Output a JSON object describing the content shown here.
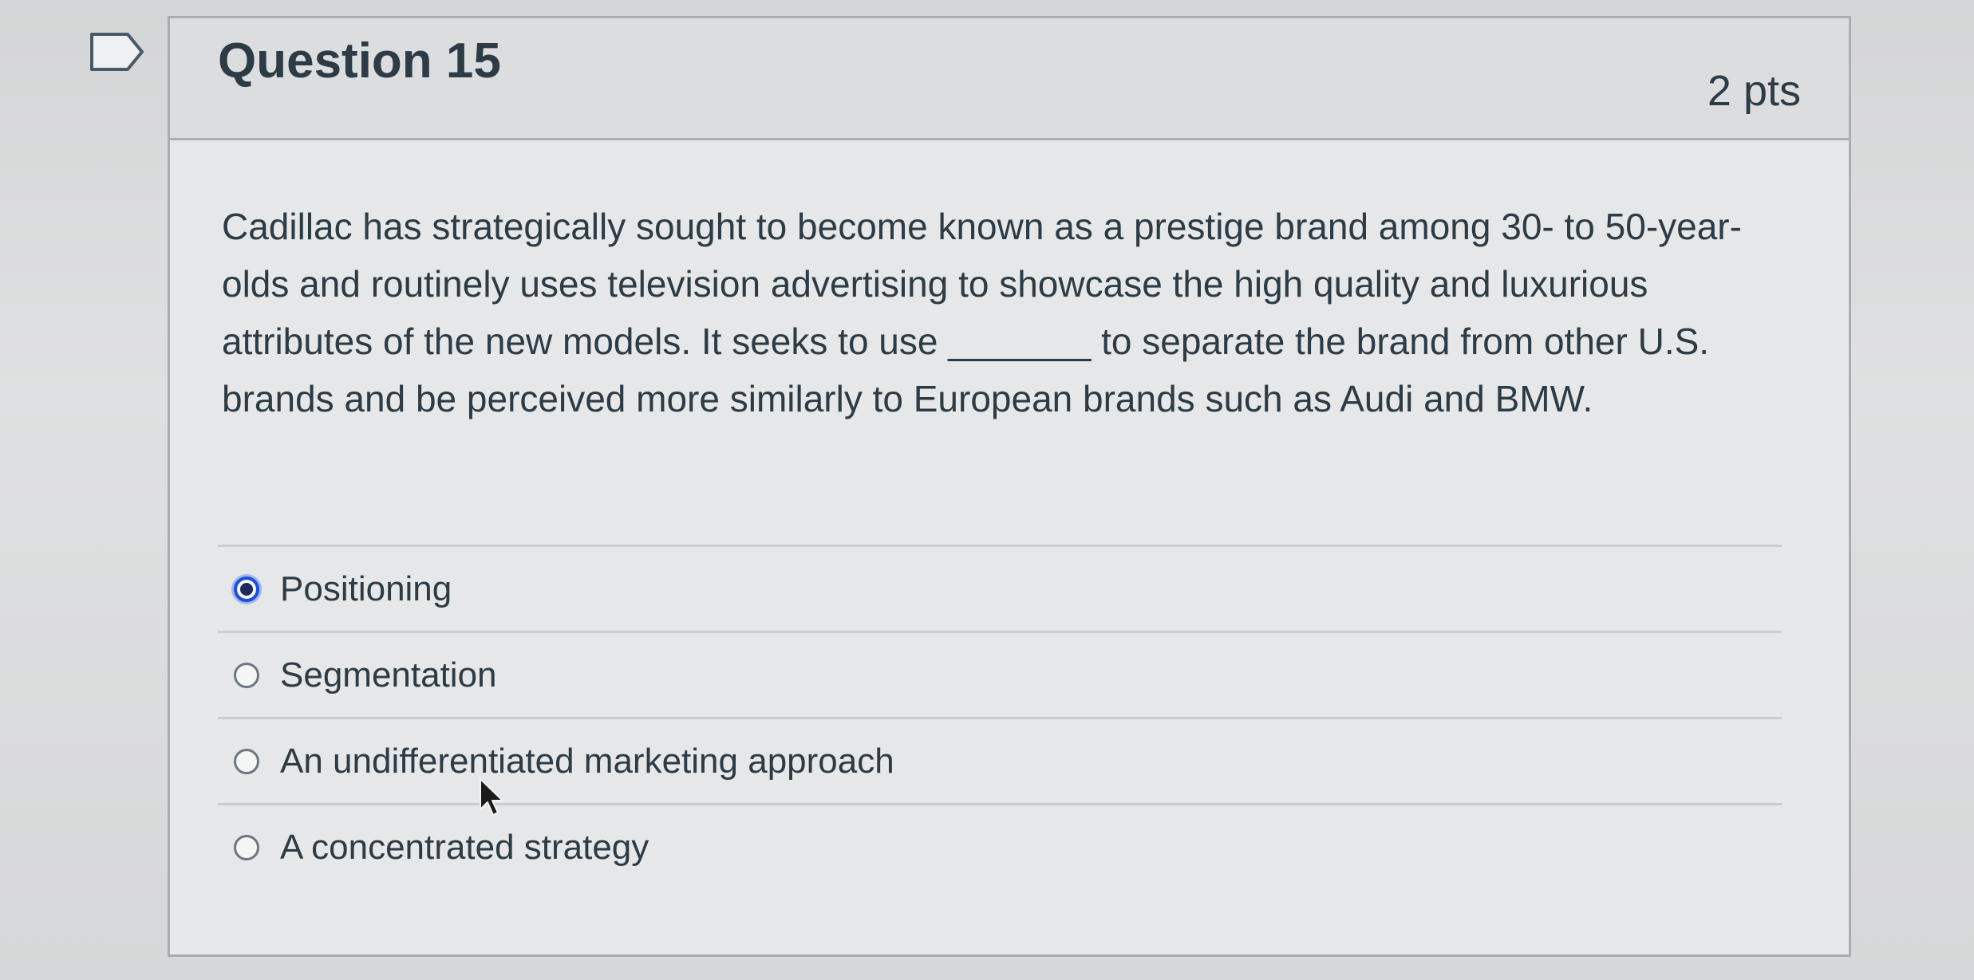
{
  "question": {
    "title": "Question 15",
    "points": "2 pts",
    "text": "Cadillac has strategically sought to become known as a prestige brand among 30- to 50-year-olds and routinely uses television advertising to showcase the high quality and luxurious attributes of the new models. It seeks to use _______ to separate the brand from other U.S. brands and be perceived more similarly to European brands such as Audi and BMW."
  },
  "answers": [
    {
      "label": "Positioning",
      "selected": true
    },
    {
      "label": "Segmentation",
      "selected": false
    },
    {
      "label": "An undifferentiated marketing approach",
      "selected": false
    },
    {
      "label": "A concentrated strategy",
      "selected": false
    }
  ],
  "icons": {
    "flag": "flag-icon",
    "cursor": "mouse-pointer-icon"
  },
  "colors": {
    "selected_radio": "#1d4fd8",
    "text": "#2d3b45"
  }
}
